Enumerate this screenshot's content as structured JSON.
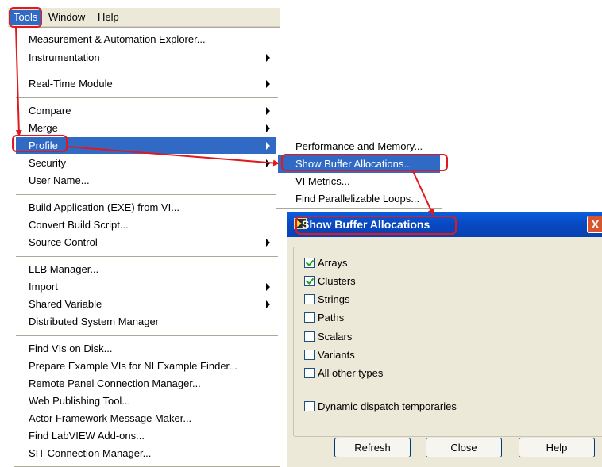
{
  "menubar": {
    "items": [
      {
        "label": "Tools"
      },
      {
        "label": "Window"
      },
      {
        "label": "Help"
      }
    ]
  },
  "tools_menu": {
    "items": [
      {
        "label": "Measurement & Automation Explorer..."
      },
      {
        "label": "Instrumentation"
      },
      {
        "label": "Real-Time Module"
      },
      {
        "label": "Compare"
      },
      {
        "label": "Merge"
      },
      {
        "label": "Profile"
      },
      {
        "label": "Security"
      },
      {
        "label": "User Name..."
      },
      {
        "label": "Build Application (EXE) from VI..."
      },
      {
        "label": "Convert Build Script..."
      },
      {
        "label": "Source Control"
      },
      {
        "label": "LLB Manager..."
      },
      {
        "label": "Import"
      },
      {
        "label": "Shared Variable"
      },
      {
        "label": "Distributed System Manager"
      },
      {
        "label": "Find VIs on Disk..."
      },
      {
        "label": "Prepare Example VIs for NI Example Finder..."
      },
      {
        "label": "Remote Panel Connection Manager..."
      },
      {
        "label": "Web Publishing Tool..."
      },
      {
        "label": "Actor Framework Message Maker..."
      },
      {
        "label": "Find LabVIEW Add-ons..."
      },
      {
        "label": "SIT Connection Manager..."
      }
    ]
  },
  "profile_submenu": {
    "items": [
      {
        "label": "Performance and Memory..."
      },
      {
        "label": "Show Buffer Allocations..."
      },
      {
        "label": "VI Metrics..."
      },
      {
        "label": "Find Parallelizable Loops..."
      }
    ]
  },
  "dialog": {
    "title": "Show Buffer Allocations",
    "close_glyph": "X",
    "options": [
      {
        "label": "Arrays",
        "checked": true
      },
      {
        "label": "Clusters",
        "checked": true
      },
      {
        "label": "Strings",
        "checked": false
      },
      {
        "label": "Paths",
        "checked": false
      },
      {
        "label": "Scalars",
        "checked": false
      },
      {
        "label": "Variants",
        "checked": false
      },
      {
        "label": "All other types",
        "checked": false
      }
    ],
    "dynamic_option": {
      "label": "Dynamic dispatch temporaries",
      "checked": false
    },
    "buttons": {
      "refresh": "Refresh",
      "close": "Close",
      "help": "Help"
    }
  },
  "colors": {
    "menu_highlight": "#316ac5",
    "annotation": "#e0191e",
    "title_bar": "#0848c0"
  }
}
